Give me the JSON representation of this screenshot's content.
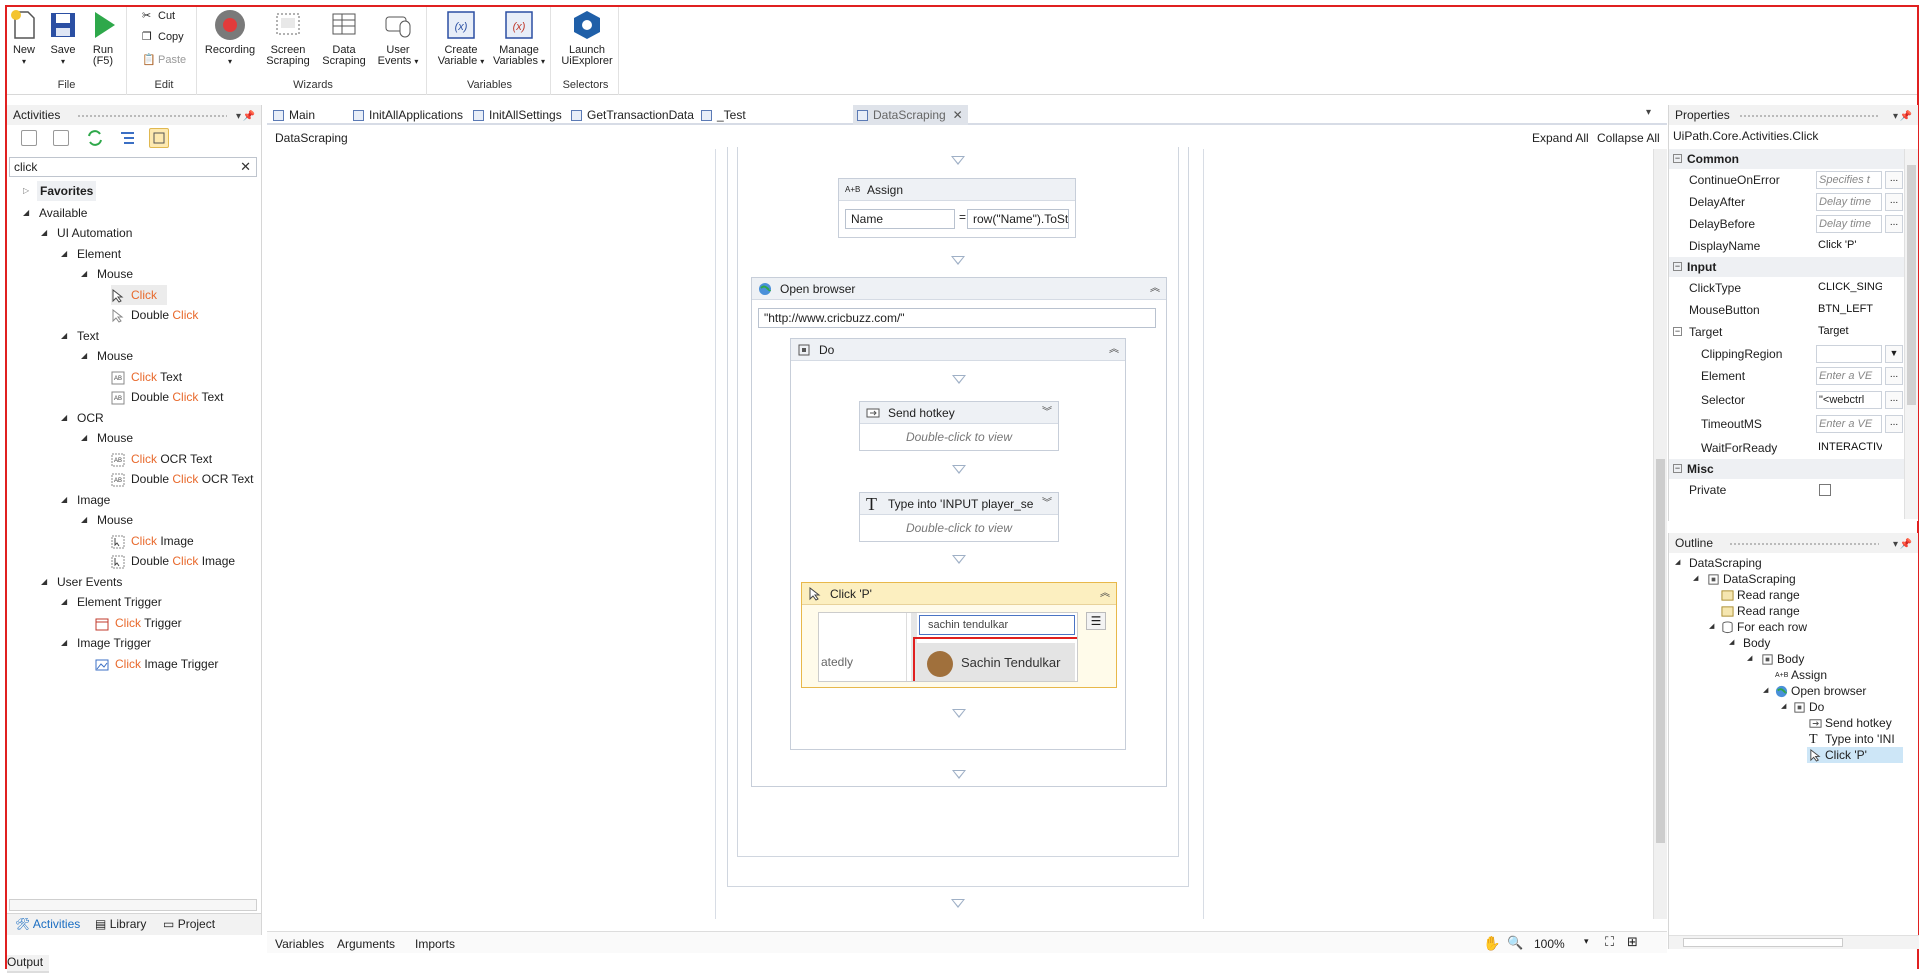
{
  "ribbon": {
    "file": {
      "label": "File",
      "new": "New",
      "save": "Save",
      "run": "Run\n(F5)",
      "run_line1": "Run",
      "run_line2": "(F5)"
    },
    "edit": {
      "label": "Edit",
      "cut": "Cut",
      "copy": "Copy",
      "paste": "Paste"
    },
    "wizards": {
      "label": "Wizards",
      "recording": "Recording",
      "screen_scraping_1": "Screen",
      "screen_scraping_2": "Scraping",
      "data_scraping_1": "Data",
      "data_scraping_2": "Scraping",
      "user_events_1": "User",
      "user_events_2": "Events"
    },
    "variables": {
      "label": "Variables",
      "create_1": "Create",
      "create_2": "Variable",
      "manage_1": "Manage",
      "manage_2": "Variables"
    },
    "selectors": {
      "label": "Selectors",
      "launch_1": "Launch",
      "launch_2": "UiExplorer"
    }
  },
  "activities": {
    "title": "Activities",
    "search_value": "click",
    "tree": [
      {
        "label": "Favorites"
      },
      {
        "label": "Available"
      },
      {
        "label": "UI Automation"
      },
      {
        "label": "Element"
      },
      {
        "label": "Mouse"
      },
      {
        "label": "Click"
      },
      {
        "pre": "Double ",
        "hl": "Click",
        "post": ""
      },
      {
        "label": "Text"
      },
      {
        "label": "Mouse"
      },
      {
        "pre": "",
        "hl": "Click",
        "post": " Text"
      },
      {
        "pre": "Double ",
        "hl": "Click",
        "post": " Text"
      },
      {
        "label": "OCR"
      },
      {
        "label": "Mouse"
      },
      {
        "pre": "",
        "hl": "Click",
        "post": " OCR Text"
      },
      {
        "pre": "Double ",
        "hl": "Click",
        "post": " OCR Text"
      },
      {
        "label": "Image"
      },
      {
        "label": "Mouse"
      },
      {
        "pre": "",
        "hl": "Click",
        "post": " Image"
      },
      {
        "pre": "Double ",
        "hl": "Click",
        "post": " Image"
      },
      {
        "label": "User Events"
      },
      {
        "label": "Element Trigger"
      },
      {
        "pre": "",
        "hl": "Click",
        "post": " Trigger"
      },
      {
        "label": "Image Trigger"
      },
      {
        "pre": "",
        "hl": "Click",
        "post": " Image Trigger"
      }
    ],
    "bottom_tabs": [
      "Activities",
      "Library",
      "Project"
    ]
  },
  "designer": {
    "tabs": [
      "Main",
      "InitAllApplications",
      "InitAllSettings",
      "GetTransactionData",
      "_Test",
      "DataScraping"
    ],
    "breadcrumb": "DataScraping",
    "expand_all": "Expand All",
    "collapse_all": "Collapse All",
    "assign": {
      "title": "Assign",
      "left": "Name",
      "eq": "=",
      "right": "row(\"Name\").ToSt"
    },
    "open_browser": {
      "title": "Open browser",
      "url": "\"http://www.cricbuzz.com/\""
    },
    "do": {
      "title": "Do"
    },
    "send_hotkey": {
      "title": "Send hotkey",
      "hint": "Double-click to view"
    },
    "type_into": {
      "title": "Type into 'INPUT  player_se",
      "hint": "Double-click to view"
    },
    "click_p": {
      "title": "Click 'P'",
      "preview_search": "sachin tendulkar",
      "preview_result": "Sachin Tendulkar",
      "preview_left": "atedly"
    },
    "bottom_tabs": [
      "Variables",
      "Arguments",
      "Imports"
    ],
    "zoom": "100%"
  },
  "properties": {
    "title": "Properties",
    "type": "UiPath.Core.Activities.Click",
    "categories": {
      "common": "Common",
      "input": "Input",
      "misc": "Misc"
    },
    "rows": {
      "continue_on_error": {
        "name": "ContinueOnError",
        "value": "Specifies t"
      },
      "delay_after": {
        "name": "DelayAfter",
        "value": "Delay time"
      },
      "delay_before": {
        "name": "DelayBefore",
        "value": "Delay time"
      },
      "display_name": {
        "name": "DisplayName",
        "value": "Click 'P'"
      },
      "click_type": {
        "name": "ClickType",
        "value": "CLICK_SINGI"
      },
      "mouse_button": {
        "name": "MouseButton",
        "value": "BTN_LEFT"
      },
      "target": {
        "name": "Target",
        "value": "Target"
      },
      "clipping_region": {
        "name": "ClippingRegion",
        "value": ""
      },
      "element": {
        "name": "Element",
        "value": "Enter a VE"
      },
      "selector": {
        "name": "Selector",
        "value": "\"<webctrl"
      },
      "timeout": {
        "name": "TimeoutMS",
        "value": "Enter a VE"
      },
      "wait_for_ready": {
        "name": "WaitForReady",
        "value": "INTERACTIV"
      },
      "private": {
        "name": "Private"
      }
    },
    "dots": "..."
  },
  "outline": {
    "title": "Outline",
    "nodes": [
      "DataScraping",
      "DataScraping",
      "Read range",
      "Read range",
      "For each row",
      "Body",
      "Body",
      "Assign",
      "Open browser",
      "Do",
      "Send hotkey",
      "Type into 'INI",
      "Click 'P'"
    ]
  },
  "status": {
    "output": "Output"
  },
  "colors": {
    "accent": "#1b6ec2",
    "highlight": "#e8692c",
    "frame": "#e02020",
    "selected": "#cde6f7"
  }
}
